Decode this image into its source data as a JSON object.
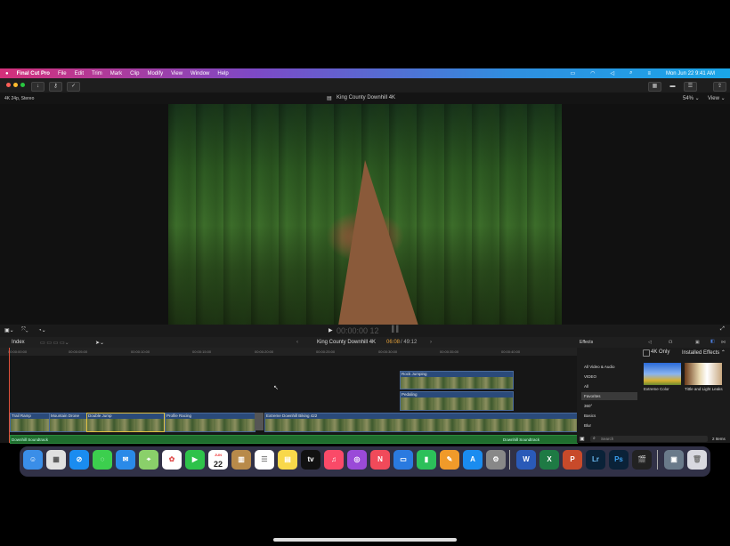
{
  "menubar": {
    "apple": "",
    "items": [
      "Final Cut Pro",
      "File",
      "Edit",
      "Trim",
      "Mark",
      "Clip",
      "Modify",
      "View",
      "Window",
      "Help"
    ],
    "datetime": "Mon Jun 22  9:41 AM"
  },
  "viewer": {
    "format": "4K 24p, Stereo",
    "title": "King County Downhill 4K",
    "zoom": "54%",
    "view_label": "View",
    "timecode": "00:00:00 12"
  },
  "timeline": {
    "index_label": "Index",
    "project_name": "King County Downhill 4K",
    "position": "06:08",
    "duration": "/ 49:12",
    "ruler": [
      "00:00:00:00",
      "00:00:05:00",
      "00:00:10:00",
      "00:00:15:00",
      "00:00:20:00",
      "00:00:25:00",
      "00:00:30:00",
      "00:00:35:00",
      "00:00:40:00"
    ],
    "connected": [
      {
        "label": "Rock Jumping"
      },
      {
        "label": "Pedaling"
      }
    ],
    "primary": [
      {
        "label": "Trail Ramp"
      },
      {
        "label": "Mountain Drone"
      },
      {
        "label": "Double Jump"
      },
      {
        "label": "Profile Racing"
      },
      {
        "label": "Extreme Downhill Biking 422"
      }
    ],
    "audio": [
      {
        "label": "Downhill Soundtrack"
      },
      {
        "label": "Downhill Soundtrack"
      }
    ]
  },
  "effects": {
    "title": "Effects",
    "only_4k": "4K Only",
    "installed": "Installed Effects",
    "categories": [
      "All Video & Audio",
      "VIDEO",
      "All",
      "Favorites",
      "360°",
      "Basics",
      "Blur"
    ],
    "selected_category": "Favorites",
    "items": [
      {
        "label": "Extreme Color"
      },
      {
        "label": "Tittle and Light Leaks"
      }
    ],
    "search_placeholder": "Search",
    "count": "2 Items"
  },
  "dock": {
    "apps": [
      "Finder",
      "Launchpad",
      "Safari",
      "Messages",
      "Mail",
      "Maps",
      "Photos",
      "FaceTime",
      "Calendar",
      "Archive",
      "Reminders",
      "Notes",
      "Apple TV",
      "Music",
      "Podcasts",
      "News",
      "Keynote",
      "Numbers",
      "Pages",
      "App Store",
      "System Preferences",
      "Word",
      "Excel",
      "PowerPoint",
      "Lightroom",
      "Photoshop",
      "Final Cut Pro",
      "Preview",
      "Trash"
    ],
    "calendar_month": "JUN",
    "calendar_day": "22"
  }
}
